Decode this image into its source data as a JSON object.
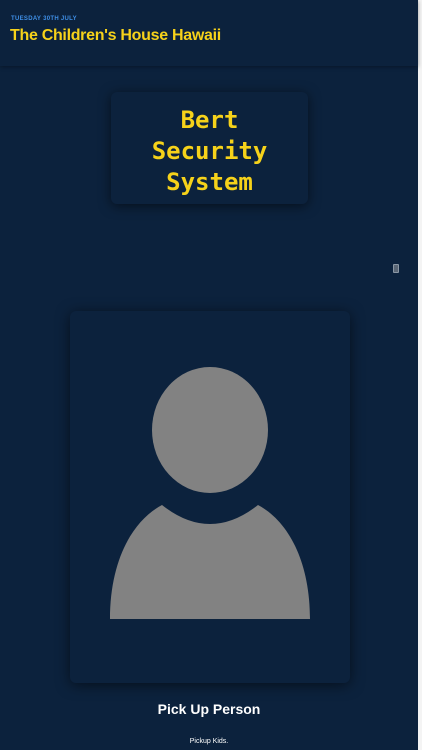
{
  "header": {
    "date": "TUESDAY 30TH JULY",
    "title": "The Children's House Hawaii"
  },
  "logo": {
    "lines": [
      "Bert",
      "Security",
      "System"
    ]
  },
  "icons": {
    "menu": "menu-icon",
    "avatar": "person-placeholder-icon"
  },
  "person": {
    "caption": "Pick Up Person",
    "subcaption": "Pickup Kids."
  },
  "colors": {
    "background": "#0c223d",
    "accent_yellow": "#f6d21a",
    "date_blue": "#3f8fe6",
    "avatar_gray": "#828282",
    "text_white": "#ffffff"
  }
}
